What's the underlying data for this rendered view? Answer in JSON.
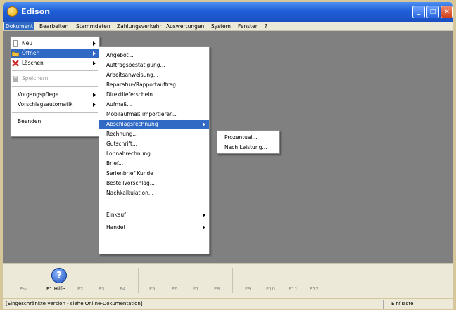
{
  "window": {
    "title": "Edison"
  },
  "menubar": [
    {
      "label": "Dokument",
      "active": true
    },
    {
      "label": "Bearbeiten"
    },
    {
      "label": "Stammdaten"
    },
    {
      "label": "Zahlungsverkehr"
    },
    {
      "label": "Auswertungen"
    },
    {
      "label": "System"
    },
    {
      "label": "Fenster"
    },
    {
      "label": "?"
    }
  ],
  "menu1": {
    "items": [
      {
        "label": "Neu",
        "icon": "new-document-icon",
        "submenu": true
      },
      {
        "label": "Öffnen",
        "icon": "open-folder-icon",
        "submenu": true,
        "highlight": true
      },
      {
        "label": "Löschen",
        "icon": "delete-x-icon",
        "submenu": true
      },
      {
        "label": "Speichern",
        "icon": "save-icon",
        "disabled": true
      },
      {
        "label": "Vorgangspflege",
        "submenu": true
      },
      {
        "label": "Vorschlagsautomatik",
        "submenu": true
      },
      {
        "label": "Beenden"
      }
    ]
  },
  "menu2": {
    "items": [
      {
        "label": "Angebot..."
      },
      {
        "label": "Auftragsbestätigung..."
      },
      {
        "label": "Arbeitsanweisung..."
      },
      {
        "label": "Reparatur-/Rapportauftrag..."
      },
      {
        "label": "Direktlieferschein..."
      },
      {
        "label": "Aufmaß..."
      },
      {
        "label": "Mobilaufmaß importieren..."
      },
      {
        "label": "Abschlagsrechnung",
        "submenu": true,
        "highlight": true
      },
      {
        "label": "Rechnung..."
      },
      {
        "label": "Gutschrift..."
      },
      {
        "label": "Lohnabrechnung..."
      },
      {
        "label": "Brief..."
      },
      {
        "label": "Serienbrief Kunde"
      },
      {
        "label": "Bestellvorschlag..."
      },
      {
        "label": "Nachkalkulation..."
      },
      {
        "label": "Einkauf",
        "submenu": true
      },
      {
        "label": "Handel",
        "submenu": true
      }
    ]
  },
  "menu3": {
    "items": [
      {
        "label": "Prozentual..."
      },
      {
        "label": "Nach Leistung..."
      }
    ]
  },
  "toolbar": {
    "fkeys": [
      "Esc",
      "F1 Hilfe",
      "F2",
      "F3",
      "F4",
      "F5",
      "F6",
      "F7",
      "F8",
      "F9",
      "F10",
      "F11",
      "F12"
    ]
  },
  "statusbar": {
    "left": "[Eingeschränkte Version - siehe Online-Dokumentation]",
    "right": "EinfTaste"
  }
}
